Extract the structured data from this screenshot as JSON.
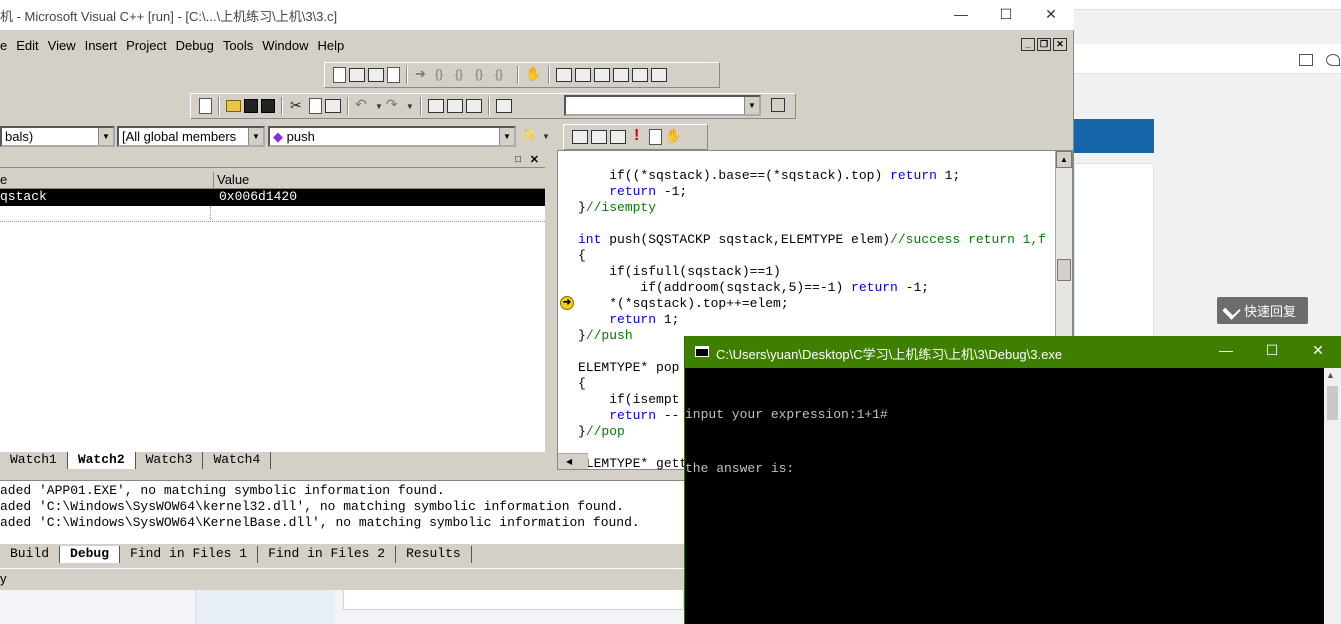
{
  "vc": {
    "title": "机 - Microsoft Visual C++ [run] - [C:\\...\\上机练习\\上机\\3\\3.c]",
    "menu": [
      "e",
      "Edit",
      "View",
      "Insert",
      "Project",
      "Debug",
      "Tools",
      "Window",
      "Help"
    ],
    "combo_scope": "bals)",
    "combo_members": "[All global members",
    "combo_function": "push",
    "find_value": ""
  },
  "watch": {
    "col_name": "e",
    "col_value": "Value",
    "row_name": "qstack",
    "row_value": "0x006d1420",
    "tabs": [
      "Watch1",
      "Watch2",
      "Watch3",
      "Watch4"
    ],
    "active_tab": "Watch2"
  },
  "code": {
    "lines": [
      "    if((*sqstack).base==(*sqstack).top) return 1;",
      "    return -1;",
      "}//isempty",
      "",
      "int push(SQSTACKP sqstack,ELEMTYPE elem)//success return 1,f",
      "{",
      "    if(isfull(sqstack)==1)",
      "        if(addroom(sqstack,5)==-1) return -1;",
      "    *(*sqstack).top++=elem;",
      "    return 1;",
      "}//push",
      "",
      "ELEMTYPE* pop",
      "{",
      "    if(isempt",
      "    return --",
      "}//pop",
      "",
      "ELEMTYPE* gett"
    ]
  },
  "output": {
    "lines": [
      "aded 'APP01.EXE', no matching symbolic information found.",
      "aded 'C:\\Windows\\SysWOW64\\kernel32.dll', no matching symbolic information found.",
      "aded 'C:\\Windows\\SysWOW64\\KernelBase.dll', no matching symbolic information found."
    ],
    "tabs": [
      "Build",
      "Debug",
      "Find in Files 1",
      "Find in Files 2",
      "Results"
    ],
    "active_tab": "Debug"
  },
  "status": "y",
  "console": {
    "title": "C:\\Users\\yuan\\Desktop\\C学习\\上机练习\\上机\\3\\Debug\\3.exe",
    "lines": [
      "input your expression:1+1#",
      "the answer is:"
    ]
  },
  "browser": {
    "reply_label": "快速回复"
  }
}
